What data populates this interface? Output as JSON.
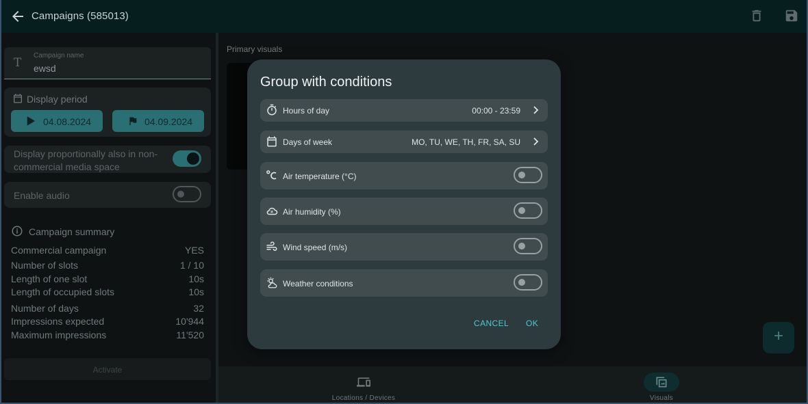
{
  "header": {
    "title": "Campaigns  (585013)"
  },
  "left": {
    "campaign_name": {
      "label": "Campaign name",
      "value": "ewsd"
    },
    "display_period": {
      "title": "Display period",
      "start": "04.08.2024",
      "end": "04.09.2024"
    },
    "proportional": {
      "label": "Display proportionally also in non-commercial media space",
      "enabled": true
    },
    "audio": {
      "label": "Enable audio",
      "enabled": false
    },
    "summary": {
      "title": "Campaign summary",
      "rows": [
        {
          "label": "Commercial campaign",
          "value": "YES"
        },
        {
          "label": "Number of slots",
          "value": "1 / 10"
        },
        {
          "label": "Length of one slot",
          "value": "10s"
        },
        {
          "label": "Length of occupied slots",
          "value": "10s"
        },
        {
          "label": "Number of days",
          "value": "32"
        },
        {
          "label": "Impressions expected",
          "value": "10'944"
        },
        {
          "label": "Maximum impressions",
          "value": "11'520"
        }
      ]
    },
    "activate_label": "Activate"
  },
  "main": {
    "section_label": "Primary visuals",
    "fab_label": "+"
  },
  "bottom_nav": {
    "items": [
      {
        "label": "Locations / Devices",
        "active": false
      },
      {
        "label": "Visuals",
        "active": true
      }
    ]
  },
  "dialog": {
    "title": "Group with conditions",
    "rows": [
      {
        "label": "Hours of day",
        "value": "00:00 - 23:59",
        "icon": "timer-icon"
      },
      {
        "label": "Days of week",
        "value": "MO, TU, WE, TH, FR, SA, SU",
        "icon": "calendar-icon"
      },
      {
        "label": "Air temperature (°C)",
        "toggle": false,
        "icon": "thermometer-celsius-icon"
      },
      {
        "label": "Air humidity (%)",
        "toggle": false,
        "icon": "cloud-humidity-icon"
      },
      {
        "label": "Wind speed (m/s)",
        "toggle": false,
        "icon": "wind-icon"
      },
      {
        "label": "Weather conditions",
        "toggle": false,
        "icon": "weather-sun-cloud-icon"
      }
    ],
    "cancel_label": "CANCEL",
    "ok_label": "OK"
  },
  "colors": {
    "accent": "#2a6f73",
    "dialog_bg": "#2e3b3e",
    "dialog_action": "#4ec9d4"
  }
}
